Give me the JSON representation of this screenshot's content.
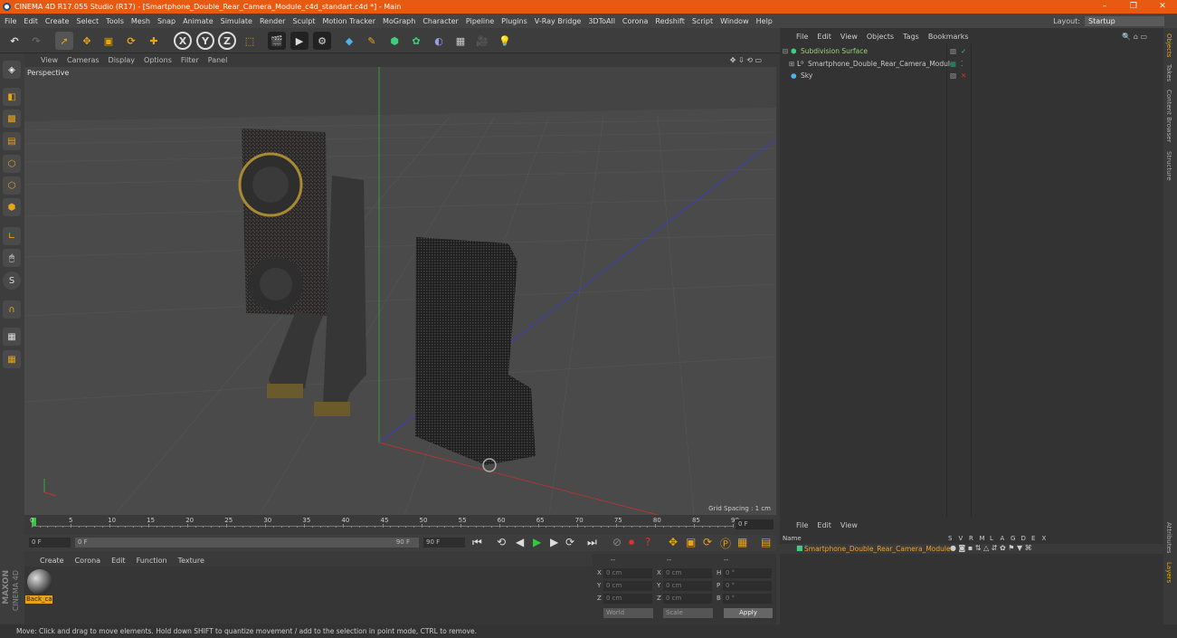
{
  "title": "CINEMA 4D R17.055 Studio (R17) - [Smartphone_Double_Rear_Camera_Module_c4d_standart.c4d *] - Main",
  "window_buttons": [
    "–",
    "❐",
    "✕"
  ],
  "menu": [
    "File",
    "Edit",
    "Create",
    "Select",
    "Tools",
    "Mesh",
    "Snap",
    "Animate",
    "Simulate",
    "Render",
    "Sculpt",
    "Motion Tracker",
    "MoGraph",
    "Character",
    "Pipeline",
    "Plugins",
    "V-Ray Bridge",
    "3DToAll",
    "Corona",
    "Redshift",
    "Script",
    "Window",
    "Help"
  ],
  "layout": {
    "label": "Layout:",
    "value": "Startup"
  },
  "toolbar": {
    "x": "X",
    "y": "Y",
    "z": "Z"
  },
  "viewport": {
    "menu": [
      "View",
      "Cameras",
      "Display",
      "Options",
      "Filter",
      "Panel"
    ],
    "label": "Perspective",
    "grid_spacing": "Grid Spacing : 1 cm"
  },
  "timeline": {
    "ticks": [
      "0",
      "5",
      "10",
      "15",
      "20",
      "25",
      "30",
      "35",
      "40",
      "45",
      "50",
      "55",
      "60",
      "65",
      "70",
      "75",
      "80",
      "85",
      "90"
    ],
    "current": "0 F",
    "start": "0 F",
    "range_start": "0 F",
    "range_end": "90 F",
    "end": "90 F"
  },
  "materials": {
    "menu": [
      "Create",
      "Corona",
      "Edit",
      "Function",
      "Texture"
    ],
    "item": "Back_cai"
  },
  "coords": {
    "rows": [
      {
        "a": "X",
        "av": "0 cm",
        "b": "X",
        "bv": "0 cm",
        "c": "H",
        "cv": "0 °"
      },
      {
        "a": "Y",
        "av": "0 cm",
        "b": "Y",
        "bv": "0 cm",
        "c": "P",
        "cv": "0 °"
      },
      {
        "a": "Z",
        "av": "0 cm",
        "b": "Z",
        "bv": "0 cm",
        "c": "B",
        "cv": "0 °"
      }
    ],
    "header": [
      "--",
      "--",
      "--"
    ],
    "world": "World",
    "scale": "Scale",
    "apply": "Apply"
  },
  "objects": {
    "menu": [
      "File",
      "Edit",
      "View",
      "Objects",
      "Tags",
      "Bookmarks"
    ],
    "items": [
      {
        "name": "Subdivision Surface",
        "color": "#99d27a"
      },
      {
        "name": "Smartphone_Double_Rear_Camera_Module",
        "color": "#c8c8c8"
      },
      {
        "name": "Sky",
        "color": "#c8c8c8"
      }
    ]
  },
  "attributes": {
    "menu": [
      "File",
      "Edit",
      "View"
    ],
    "columns": [
      "Name",
      "S",
      "V",
      "R",
      "M",
      "L",
      "A",
      "G",
      "D",
      "E",
      "X"
    ],
    "item": "Smartphone_Double_Rear_Camera_Module"
  },
  "right_tabs": [
    "Objects",
    "Takes",
    "Content Browser",
    "Structure"
  ],
  "right_tabs_bottom": [
    "Attributes",
    "Layers"
  ],
  "maxon": {
    "brand": "MAXON",
    "product": "CINEMA 4D"
  },
  "status": "Move: Click and drag to move elements. Hold down SHIFT to quantize movement / add to the selection in point mode, CTRL to remove.",
  "colors": {
    "titlebar": "#e85a11",
    "accent": "#e8a317",
    "selected": "#f0a030"
  }
}
